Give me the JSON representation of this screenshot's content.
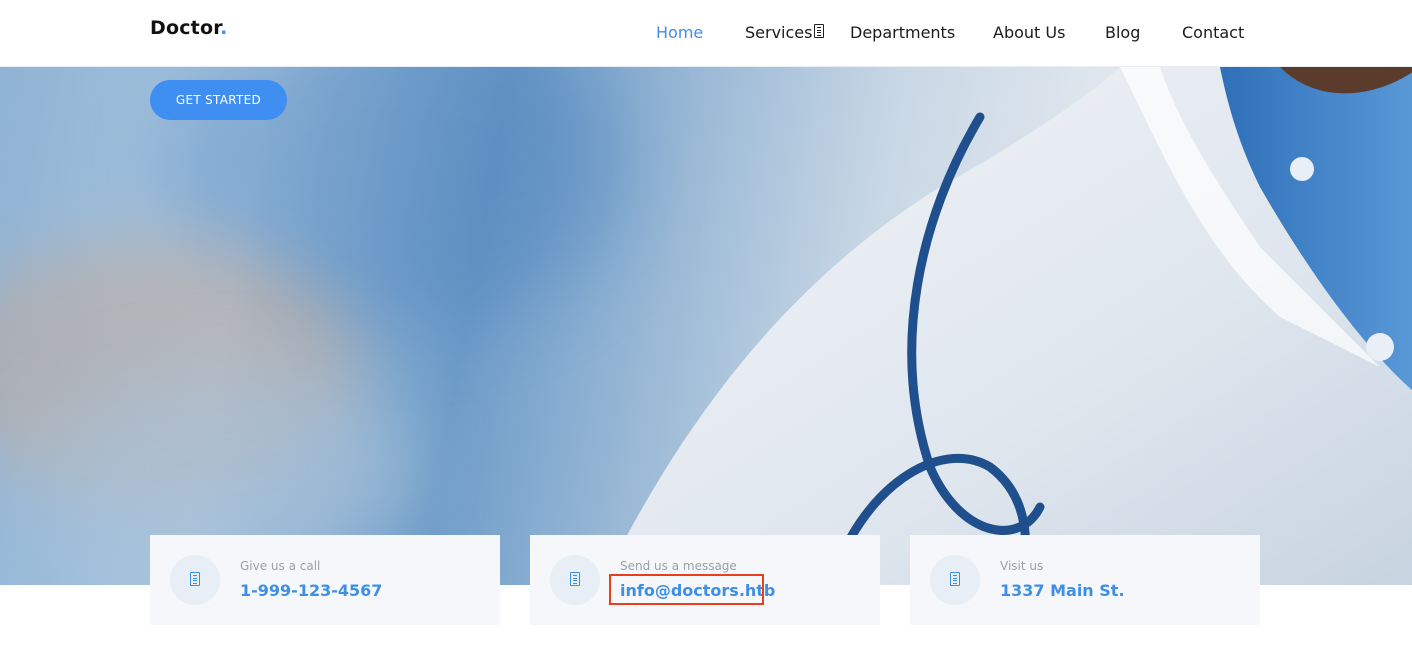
{
  "header": {
    "logo_text": "Doctor",
    "logo_dot": ".",
    "nav": [
      {
        "label": "Home",
        "active": true
      },
      {
        "label": "Services",
        "active": false
      },
      {
        "label": "Departments",
        "active": false
      },
      {
        "label": "About Us",
        "active": false
      },
      {
        "label": "Blog",
        "active": false
      },
      {
        "label": "Contact",
        "active": false
      }
    ]
  },
  "hero": {
    "cta_label": "GET STARTED"
  },
  "info": [
    {
      "label": "Give us a call",
      "value": "1-999-123-4567",
      "icon": "phone-icon"
    },
    {
      "label": "Send us a message",
      "value": "info@doctors.htb",
      "icon": "envelope-icon"
    },
    {
      "label": "Visit us",
      "value": "1337 Main St.",
      "icon": "map-marker-icon"
    }
  ],
  "colors": {
    "accent": "#3f8fe6",
    "button": "#3f8ff2",
    "highlight": "#e8401c"
  }
}
